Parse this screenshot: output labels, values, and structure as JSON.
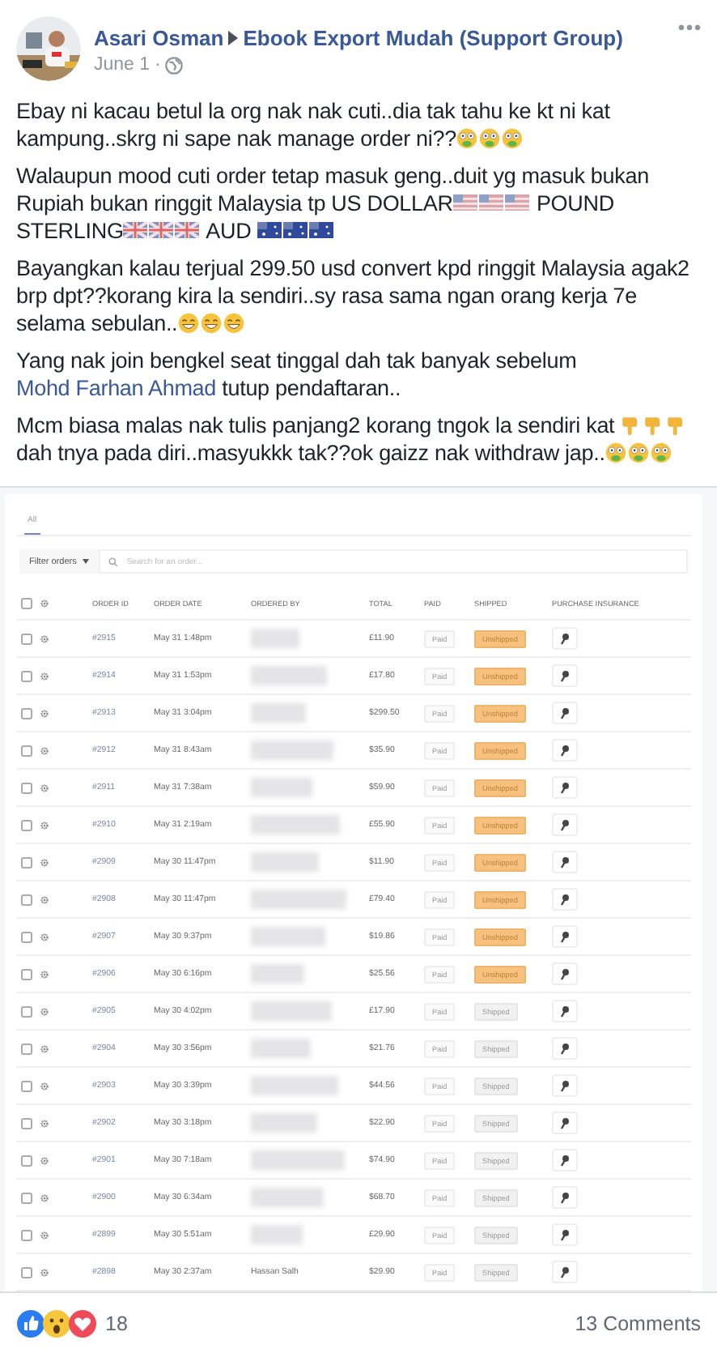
{
  "post": {
    "author": "Asari Osman",
    "group": "Ebook Export Mudah (Support Group)",
    "date": "June 1",
    "separator": "·",
    "paragraphs": [
      [
        {
          "kind": "text",
          "text": "Ebay ni kacau betul la org nak nak cuti..dia tak tahu ke kt ni kat kampung..skrg ni sape nak manage order ni??"
        },
        {
          "kind": "sick-face"
        },
        {
          "kind": "sick-face"
        },
        {
          "kind": "sick-face"
        }
      ],
      [
        {
          "kind": "text",
          "text": "Walaupun mood cuti order tetap masuk geng..duit yg masuk bukan Rupiah bukan ringgit Malaysia tp US DOLLAR"
        },
        {
          "kind": "us-flag"
        },
        {
          "kind": "us-flag"
        },
        {
          "kind": "us-flag"
        },
        {
          "kind": "text",
          "text": " POUND STERLING"
        },
        {
          "kind": "uk-flag"
        },
        {
          "kind": "uk-flag"
        },
        {
          "kind": "uk-flag"
        },
        {
          "kind": "text",
          "text": " AUD "
        },
        {
          "kind": "au-flag"
        },
        {
          "kind": "au-flag"
        },
        {
          "kind": "au-flag"
        }
      ],
      [
        {
          "kind": "text",
          "text": "Bayangkan kalau terjual 299.50 usd convert kpd ringgit Malaysia agak2 brp dpt??korang kira la sendiri..sy rasa sama ngan orang kerja 7e selama sebulan.."
        },
        {
          "kind": "grin-face"
        },
        {
          "kind": "grin-face"
        },
        {
          "kind": "grin-face"
        }
      ],
      [
        {
          "kind": "text",
          "text": "Yang nak join bengkel seat tinggal dah tak banyak sebelum "
        },
        {
          "kind": "link",
          "text": "Mohd Farhan Ahmad"
        },
        {
          "kind": "text",
          "text": " tutup pendaftaran.."
        }
      ],
      [
        {
          "kind": "text",
          "text": "Mcm biasa malas nak tulis panjang2 korang tngok la sendiri kat "
        },
        {
          "kind": "hand"
        },
        {
          "kind": "hand"
        },
        {
          "kind": "hand"
        },
        {
          "kind": "text",
          "text": " dah tnya pada diri..masyukkk tak??ok gaizz nak withdraw jap.."
        },
        {
          "kind": "sick-face"
        },
        {
          "kind": "sick-face"
        },
        {
          "kind": "sick-face"
        }
      ]
    ]
  },
  "orders": {
    "tabs": [
      {
        "label": "All",
        "selected": true
      }
    ],
    "filter": "Filter orders",
    "search": {
      "placeholder": "Search for an order..."
    },
    "select_all_checked": false,
    "columns": [
      "ORDER ID",
      "ORDER DATE",
      "ORDERED BY",
      "TOTAL",
      "PAID",
      "SHIPPED",
      "PURCHASE INSURANCE"
    ],
    "rows": [
      {
        "checked": false,
        "id": "#2915",
        "date": "May 31 1:48pm",
        "redacted": true,
        "total": "£11.90",
        "paid": "Paid",
        "shipped": false,
        "status": "Unshipped"
      },
      {
        "checked": false,
        "id": "#2914",
        "date": "May 31 1:53pm",
        "redacted": true,
        "total": "£17.80",
        "paid": "Paid",
        "shipped": false,
        "status": "Unshipped"
      },
      {
        "checked": false,
        "id": "#2913",
        "date": "May 31 3:04pm",
        "redacted": true,
        "total": "$299.50",
        "paid": "Paid",
        "shipped": false,
        "status": "Unshipped"
      },
      {
        "checked": false,
        "id": "#2912",
        "date": "May 31 8:43am",
        "redacted": true,
        "total": "$35.90",
        "paid": "Paid",
        "shipped": false,
        "status": "Unshipped"
      },
      {
        "checked": false,
        "id": "#2911",
        "date": "May 31 7:38am",
        "redacted": true,
        "total": "$59.90",
        "paid": "Paid",
        "shipped": false,
        "status": "Unshipped"
      },
      {
        "checked": false,
        "id": "#2910",
        "date": "May 31 2:19am",
        "redacted": true,
        "total": "£55.90",
        "paid": "Paid",
        "shipped": false,
        "status": "Unshipped"
      },
      {
        "checked": false,
        "id": "#2909",
        "date": "May 30 11:47pm",
        "redacted": true,
        "total": "$11.90",
        "paid": "Paid",
        "shipped": false,
        "status": "Unshipped"
      },
      {
        "checked": false,
        "id": "#2908",
        "date": "May 30 11:47pm",
        "redacted": true,
        "total": "£79.40",
        "paid": "Paid",
        "shipped": false,
        "status": "Unshipped"
      },
      {
        "checked": false,
        "id": "#2907",
        "date": "May 30 9:37pm",
        "redacted": true,
        "total": "$19.86",
        "paid": "Paid",
        "shipped": false,
        "status": "Unshipped"
      },
      {
        "checked": false,
        "id": "#2906",
        "date": "May 30 6:16pm",
        "redacted": true,
        "total": "$25.56",
        "paid": "Paid",
        "shipped": false,
        "status": "Unshipped"
      },
      {
        "checked": false,
        "id": "#2905",
        "date": "May 30 4:02pm",
        "redacted": true,
        "total": "£17.90",
        "paid": "Paid",
        "shipped": true,
        "status": "Shipped"
      },
      {
        "checked": false,
        "id": "#2904",
        "date": "May 30 3:56pm",
        "redacted": true,
        "total": "$21.76",
        "paid": "Paid",
        "shipped": true,
        "status": "Shipped"
      },
      {
        "checked": false,
        "id": "#2903",
        "date": "May 30 3:39pm",
        "redacted": true,
        "total": "$44.56",
        "paid": "Paid",
        "shipped": true,
        "status": "Shipped"
      },
      {
        "checked": false,
        "id": "#2902",
        "date": "May 30 3:18pm",
        "redacted": true,
        "total": "$22.90",
        "paid": "Paid",
        "shipped": true,
        "status": "Shipped"
      },
      {
        "checked": false,
        "id": "#2901",
        "date": "May 30 7:18am",
        "redacted": true,
        "total": "$74.90",
        "paid": "Paid",
        "shipped": true,
        "status": "Shipped"
      },
      {
        "checked": false,
        "id": "#2900",
        "date": "May 30 6:34am",
        "redacted": true,
        "total": "$68.70",
        "paid": "Paid",
        "shipped": true,
        "status": "Shipped"
      },
      {
        "checked": false,
        "id": "#2899",
        "date": "May 30 5:51am",
        "redacted": true,
        "total": "£29.90",
        "paid": "Paid",
        "shipped": true,
        "status": "Shipped"
      },
      {
        "checked": false,
        "id": "#2898",
        "date": "May 30 2:37am",
        "redacted": false,
        "ordered_by": "Hassan Salh",
        "total": "$29.90",
        "paid": "Paid",
        "shipped": true,
        "status": "Shipped"
      }
    ]
  },
  "footer": {
    "reaction_count": "18",
    "comments": "13 Comments"
  }
}
